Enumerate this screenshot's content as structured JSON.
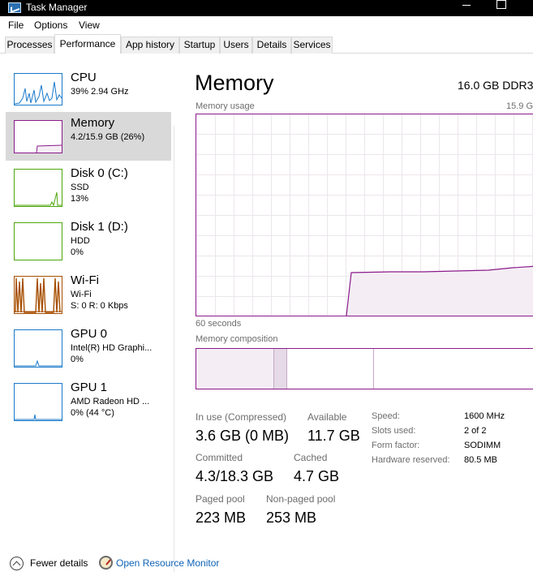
{
  "window": {
    "title": "Task Manager"
  },
  "menu": [
    "File",
    "Options",
    "View"
  ],
  "tabs": [
    "Processes",
    "Performance",
    "App history",
    "Startup",
    "Users",
    "Details",
    "Services"
  ],
  "active_tab": "Performance",
  "sidebar": {
    "items": [
      {
        "name": "CPU",
        "sub1": "39% 2.94 GHz",
        "sub2": "",
        "color": "#1979ca"
      },
      {
        "name": "Memory",
        "sub1": "4.2/15.9 GB (26%)",
        "sub2": "",
        "color": "#8b1a8b"
      },
      {
        "name": "Disk 0 (C:)",
        "sub1": "SSD",
        "sub2": "13%",
        "color": "#4da60c"
      },
      {
        "name": "Disk 1 (D:)",
        "sub1": "HDD",
        "sub2": "0%",
        "color": "#4da60c"
      },
      {
        "name": "Wi-Fi",
        "sub1": "Wi-Fi",
        "sub2": "S: 0 R: 0 Kbps",
        "color": "#a74f01"
      },
      {
        "name": "GPU 0",
        "sub1": "Intel(R) HD Graphi...",
        "sub2": "0%",
        "color": "#1979ca"
      },
      {
        "name": "GPU 1",
        "sub1": "AMD Radeon HD ...",
        "sub2": "0% (44 °C)",
        "color": "#1979ca"
      }
    ]
  },
  "main": {
    "title": "Memory",
    "model": "16.0 GB DDR3",
    "usage_label": "Memory usage",
    "usage_max": "15.9 G",
    "time_label": "60 seconds",
    "composition_label": "Memory composition",
    "stats": {
      "in_use_label": "In use (Compressed)",
      "in_use_value": "3.6 GB (0 MB)",
      "available_label": "Available",
      "available_value": "11.7 GB",
      "committed_label": "Committed",
      "committed_value": "4.3/18.3 GB",
      "cached_label": "Cached",
      "cached_value": "4.7 GB",
      "paged_label": "Paged pool",
      "paged_value": "223 MB",
      "nonpaged_label": "Non-paged pool",
      "nonpaged_value": "253 MB"
    },
    "specs": [
      {
        "key": "Speed:",
        "value": "1600 MHz"
      },
      {
        "key": "Slots used:",
        "value": "2 of 2"
      },
      {
        "key": "Form factor:",
        "value": "SODIMM"
      },
      {
        "key": "Hardware reserved:",
        "value": "80.5 MB"
      }
    ]
  },
  "footer": {
    "fewer_details": "Fewer details",
    "open_resource_monitor": "Open Resource Monitor"
  },
  "colors": {
    "memory": "#8b1a8b",
    "memory_fill": "#f4eef4",
    "grid": "#ece6ec",
    "link": "#0f63b8"
  }
}
